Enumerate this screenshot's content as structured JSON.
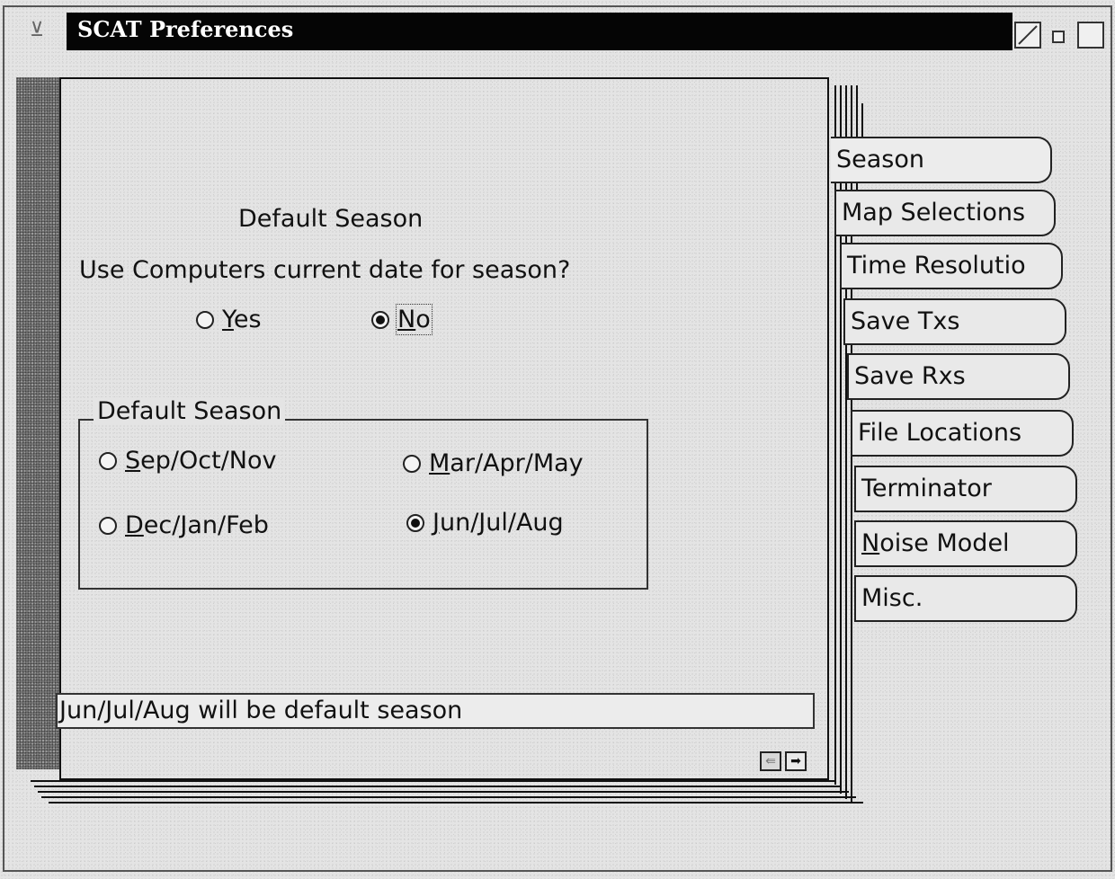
{
  "window": {
    "title": "SCAT Preferences",
    "menu_glyph": "⊻",
    "controls": [
      "restore",
      "minimize",
      "maximize"
    ]
  },
  "season_page": {
    "heading": "Default Season",
    "question": "Use Computers current date for season?",
    "use_current_date": {
      "options": [
        {
          "mnemonic": "Y",
          "rest": "es",
          "selected": false
        },
        {
          "mnemonic": "N",
          "rest": "o",
          "selected": true
        }
      ]
    },
    "default_season_group": {
      "title": "Default Season",
      "options": [
        {
          "mnemonic": "S",
          "rest": "ep/Oct/Nov",
          "selected": false
        },
        {
          "mnemonic": "M",
          "rest": "ar/Apr/May",
          "selected": false
        },
        {
          "mnemonic": "D",
          "rest": "ec/Jan/Feb",
          "selected": false
        },
        {
          "mnemonic": "J",
          "rest": "un/Jul/Aug",
          "selected": true
        }
      ]
    },
    "status_message": "Jun/Jul/Aug will be default season"
  },
  "pager": {
    "prev_glyph": "⇚",
    "next_glyph": "➡"
  },
  "tabs": [
    {
      "label": "Season",
      "active": true
    },
    {
      "label": "Map Selections",
      "active": false
    },
    {
      "label": "Time Resolutio",
      "active": false
    },
    {
      "label": "Save Txs",
      "active": false
    },
    {
      "label": "Save Rxs",
      "active": false
    },
    {
      "label": "File Locations",
      "active": false
    },
    {
      "label": "Terminator",
      "active": false
    },
    {
      "mnemonic": "N",
      "rest": "oise Model",
      "active": false
    },
    {
      "label": "Misc.",
      "active": false
    }
  ]
}
